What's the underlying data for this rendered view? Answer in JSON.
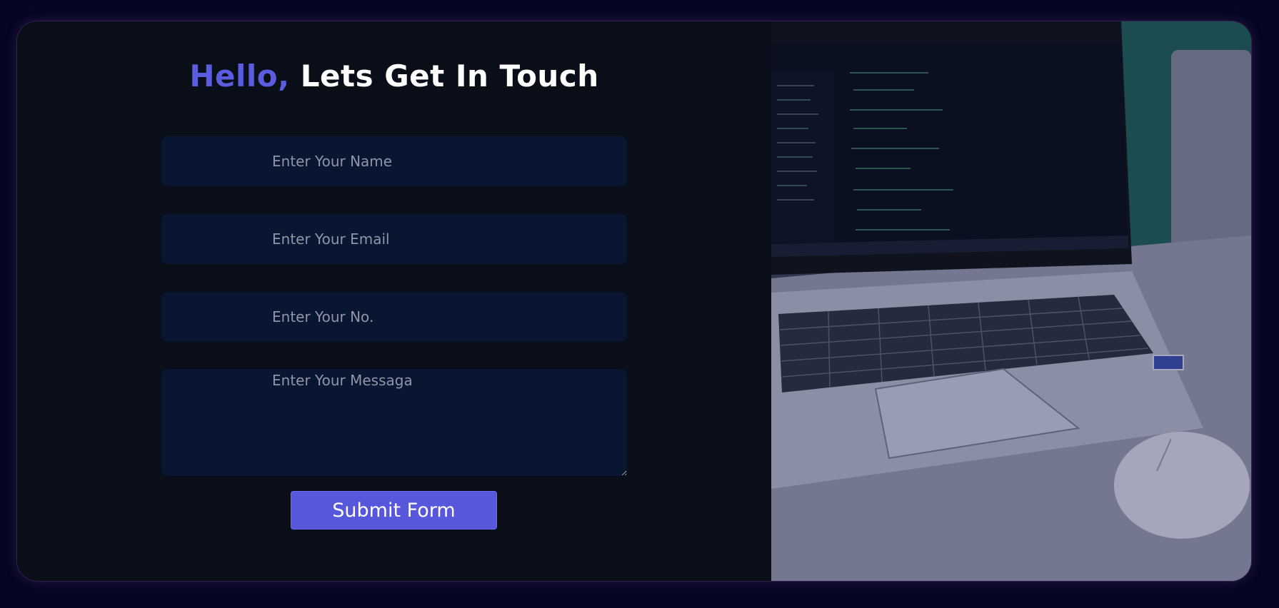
{
  "heading": {
    "accent": "Hello,",
    "rest": " Lets Get In Touch"
  },
  "form": {
    "name_placeholder": "Enter Your Name",
    "email_placeholder": "Enter Your Email",
    "phone_placeholder": "Enter Your No.",
    "message_placeholder": "Enter Your Messaga",
    "submit_label": "Submit Form"
  },
  "colors": {
    "page_background": "#050622",
    "card_background": "#0a0e18",
    "accent": "#5a5ddf",
    "input_background": "#081631",
    "button_background": "#5757db"
  }
}
